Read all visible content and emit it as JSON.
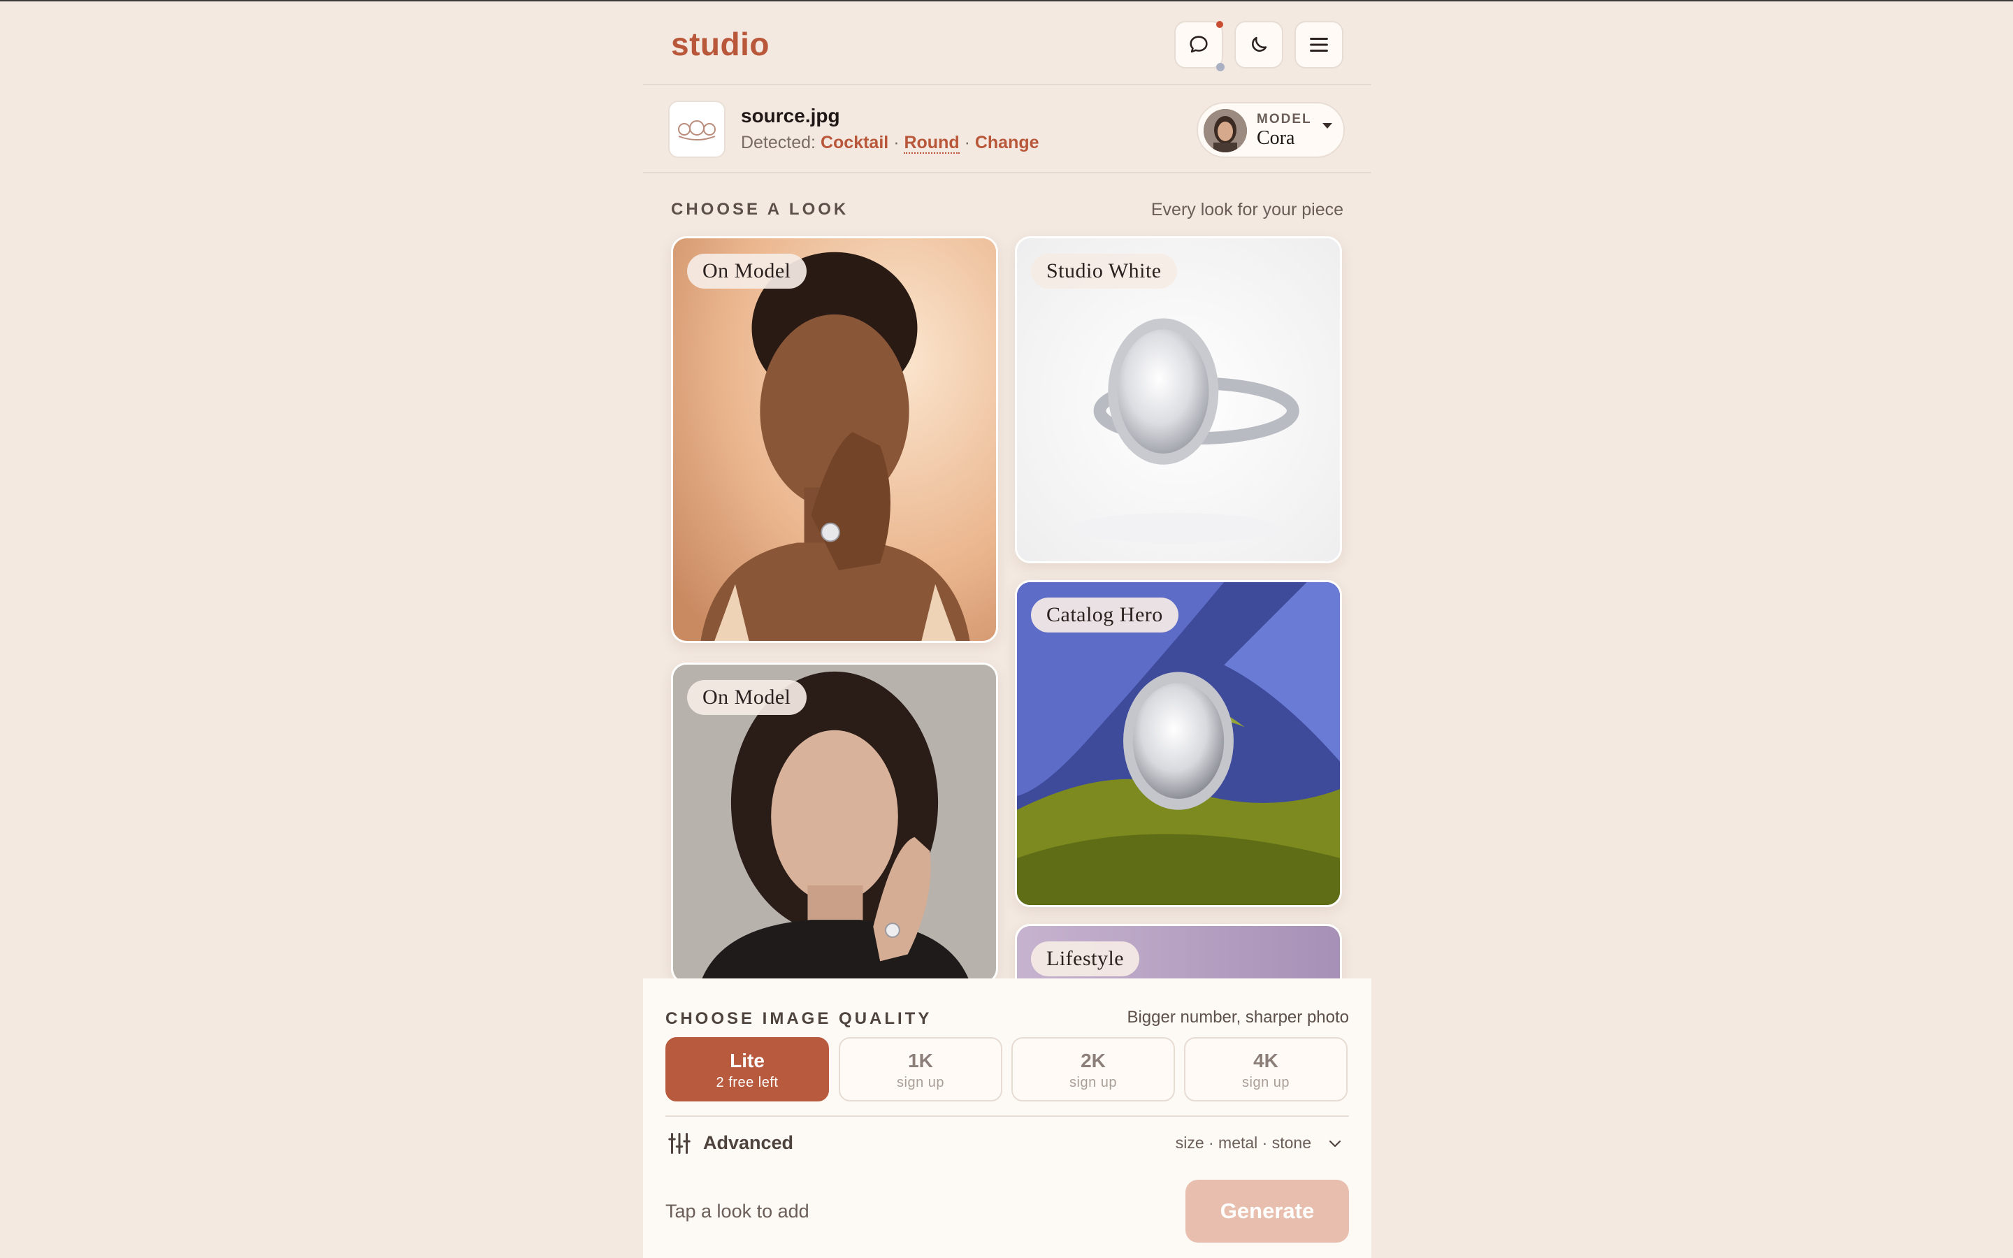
{
  "header": {
    "brand": "studio",
    "buttons": [
      {
        "icon": "chat-bubble-icon"
      },
      {
        "icon": "moon-icon"
      },
      {
        "icon": "hamburger-menu-icon"
      }
    ]
  },
  "source": {
    "filename": "source.jpg",
    "detected_prefix": "Detected:",
    "category": "Cocktail",
    "shape": "Round",
    "change": "Change",
    "separator": "·"
  },
  "model": {
    "kicker": "MODEL",
    "name": "Cora"
  },
  "looks": {
    "title": "CHOOSE A LOOK",
    "subtitle": "Every look for your piece",
    "cards": [
      {
        "label": "On Model"
      },
      {
        "label": "Studio White"
      },
      {
        "label": "On Model"
      },
      {
        "label": "Catalog Hero"
      },
      {
        "label": "Lifestyle"
      }
    ]
  },
  "quality": {
    "title": "CHOOSE IMAGE QUALITY",
    "subtitle": "Bigger number, sharper photo",
    "options": [
      {
        "label": "Lite",
        "note": "2 free left",
        "selected": true
      },
      {
        "label": "1K",
        "note": "sign up",
        "selected": false
      },
      {
        "label": "2K",
        "note": "sign up",
        "selected": false
      },
      {
        "label": "4K",
        "note": "sign up",
        "selected": false
      }
    ]
  },
  "advanced": {
    "label": "Advanced",
    "meta": "size · metal · stone"
  },
  "footer": {
    "hint": "Tap a look to add",
    "generate": "Generate"
  },
  "colors": {
    "accent": "#b9573a",
    "background": "#f3e9e1",
    "panel": "#fdf9f5",
    "generate_disabled": "#e8bfae"
  }
}
